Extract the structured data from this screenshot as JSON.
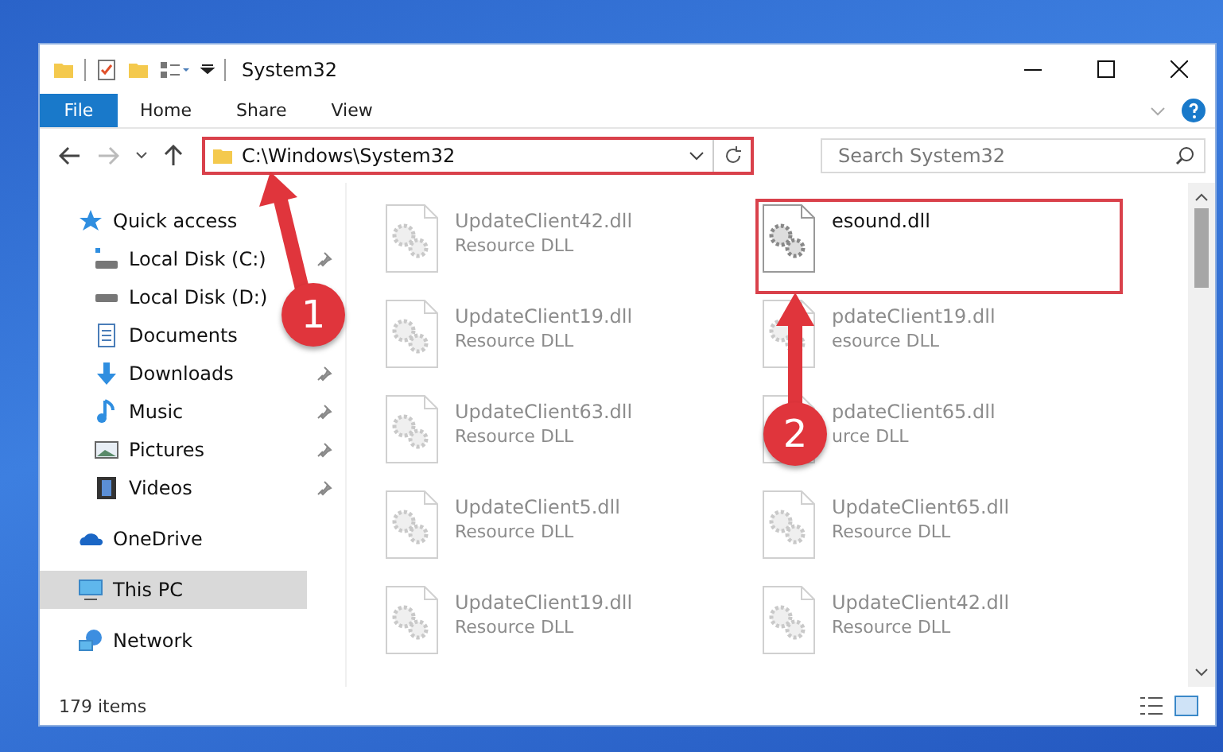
{
  "window": {
    "title": "System32"
  },
  "ribbon": {
    "tabs": [
      {
        "label": "File",
        "selected": true
      },
      {
        "label": "Home",
        "selected": false
      },
      {
        "label": "Share",
        "selected": false
      },
      {
        "label": "View",
        "selected": false
      }
    ]
  },
  "address_bar": {
    "path": "C:\\Windows\\System32",
    "highlighted": true
  },
  "search": {
    "placeholder": "Search System32"
  },
  "sidebar": {
    "items": [
      {
        "label": "Quick access",
        "kind": "star",
        "selected": false,
        "children": [
          {
            "label": "Local Disk (C:)",
            "kind": "drive-c",
            "pinned": true
          },
          {
            "label": "Local Disk (D:)",
            "kind": "drive"
          },
          {
            "label": "Documents",
            "kind": "documents"
          },
          {
            "label": "Downloads",
            "kind": "downloads",
            "pinned": true
          },
          {
            "label": "Music",
            "kind": "music",
            "pinned": true
          },
          {
            "label": "Pictures",
            "kind": "pictures",
            "pinned": true
          },
          {
            "label": "Videos",
            "kind": "videos",
            "pinned": true
          }
        ]
      },
      {
        "label": "OneDrive",
        "kind": "cloud",
        "selected": false
      },
      {
        "label": "This PC",
        "kind": "pc",
        "selected": true
      },
      {
        "label": "Network",
        "kind": "network",
        "selected": false
      }
    ]
  },
  "files": [
    {
      "name": "UpdateClient42.dll",
      "type": "Resource DLL",
      "blurred": true,
      "highlighted": false
    },
    {
      "name": "esound.dll",
      "blurred": false,
      "highlighted": true
    },
    {
      "name": "UpdateClient19.dll",
      "type": "Resource DLL",
      "blurred": true,
      "highlighted": false
    },
    {
      "name": "pdateClient19.dll",
      "type": "esource DLL",
      "blurred": true,
      "highlighted": false
    },
    {
      "name": "UpdateClient63.dll",
      "type": "Resource DLL",
      "blurred": true,
      "highlighted": false
    },
    {
      "name": "pdateClient65.dll",
      "type": "urce DLL",
      "blurred": true,
      "highlighted": false
    },
    {
      "name": "UpdateClient5.dll",
      "type": "Resource DLL",
      "blurred": true,
      "highlighted": false
    },
    {
      "name": "UpdateClient65.dll",
      "type": "Resource DLL",
      "blurred": true,
      "highlighted": false
    },
    {
      "name": "UpdateClient19.dll",
      "type": "Resource DLL",
      "blurred": true,
      "highlighted": false
    },
    {
      "name": "UpdateClient42.dll",
      "type": "Resource DLL",
      "blurred": true,
      "highlighted": false
    }
  ],
  "status_bar": {
    "item_count": "179 items"
  },
  "callouts": [
    {
      "number": "1"
    },
    {
      "number": "2"
    }
  ]
}
